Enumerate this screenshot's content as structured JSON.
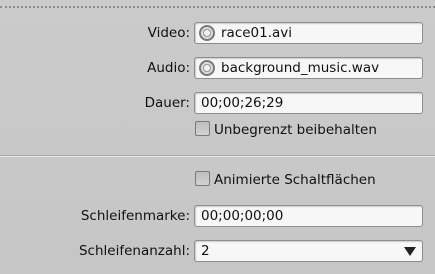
{
  "fields": {
    "video": {
      "label": "Video:",
      "value": "race01.avi",
      "icon": "media-file-icon"
    },
    "audio": {
      "label": "Audio:",
      "value": "background_music.wav",
      "icon": "media-file-icon"
    },
    "dauer": {
      "label": "Dauer:",
      "value": "00;00;26;29"
    },
    "unbegrenzt": {
      "label": "Unbegrenzt beibehalten",
      "checked": false
    },
    "animiert": {
      "label": "Animierte Schaltflächen",
      "checked": false
    },
    "schleifenmarke": {
      "label": "Schleifenmarke:",
      "value": "00;00;00;00"
    },
    "schleifenanzahl": {
      "label": "Schleifenanzahl:",
      "value": "2"
    }
  }
}
